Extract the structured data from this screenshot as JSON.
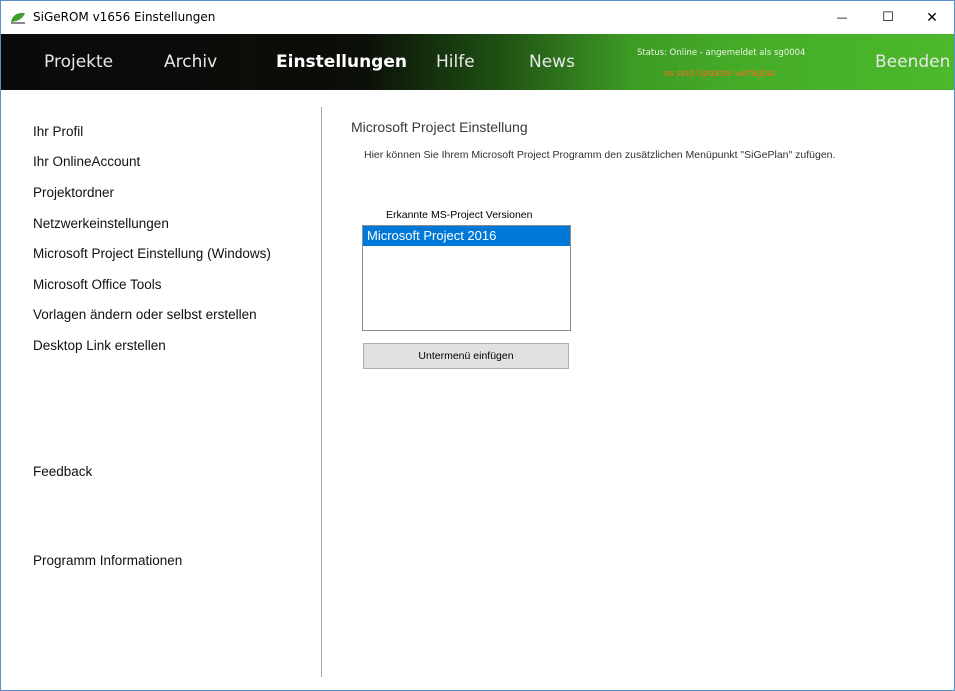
{
  "window": {
    "title": "SiGeROM v1656  Einstellungen",
    "controls": {
      "minimize": "—",
      "maximize": "☐",
      "close": "✕"
    }
  },
  "nav": {
    "items": [
      "Projekte",
      "Archiv",
      "Einstellungen",
      "Hilfe",
      "News"
    ],
    "active": "Einstellungen",
    "status_line1": "Status: Online - angemeldet als sg0004",
    "status_line2": "es sind Updates verfügbar",
    "exit_label": "Beenden"
  },
  "sidebar": {
    "items": [
      "Ihr Profil",
      "Ihr OnlineAccount",
      "Projektordner",
      "Netzwerkeinstellungen",
      "Microsoft Project Einstellung (Windows)",
      "Microsoft Office Tools",
      "Vorlagen ändern oder selbst erstellen",
      "Desktop Link erstellen",
      "Feedback",
      "Programm Informationen"
    ]
  },
  "main": {
    "title": "Microsoft Project Einstellung",
    "description": "Hier können Sie Ihrem Microsoft Project Programm den zusätzlichen Menüpunkt \"SiGePlan\" zufügen.",
    "list_label": "Erkannte MS-Project Versionen",
    "versions": [
      "Microsoft Project 2016"
    ],
    "selected_version": "Microsoft Project 2016",
    "button_label": "Untermenü einfügen"
  },
  "colors": {
    "accent_green": "#4cb82c",
    "selection_blue": "#0078d7",
    "status_warning": "#ff6a1f"
  },
  "icons": {
    "app": "sigerom-leaf-icon"
  }
}
